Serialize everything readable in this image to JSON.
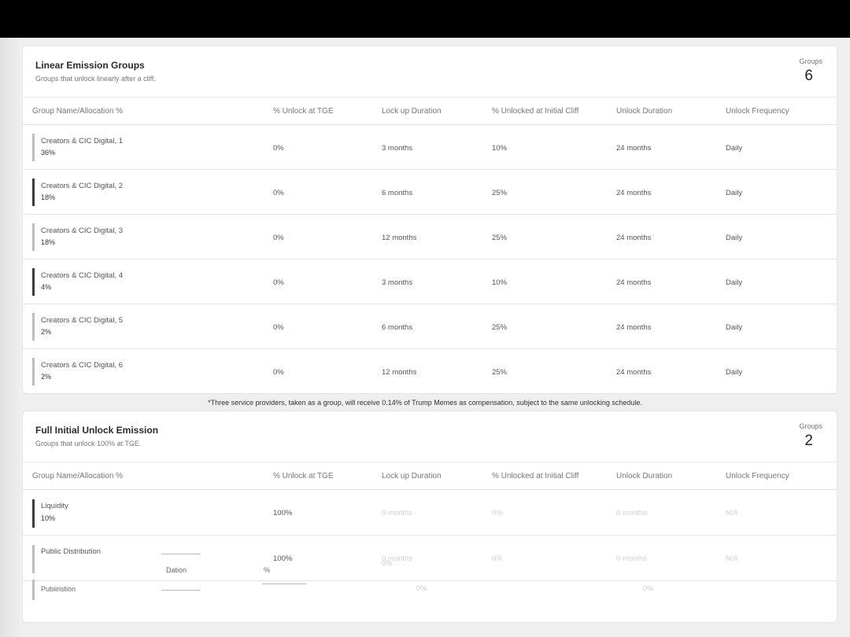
{
  "linear": {
    "title": "Linear Emission Groups",
    "subtitle": "Groups that unlock linearly after a cliff.",
    "count_label": "Groups",
    "count": "6",
    "columns": [
      "Group Name/Allocation %",
      "% Unlock at TGE",
      "Lock up Duration",
      "% Unlocked at Initial Cliff",
      "Unlock Duration",
      "Unlock Frequency"
    ],
    "rows": [
      {
        "name": "Creators & CIC Digital, 1",
        "pct": "36%",
        "tge": "0%",
        "lockup": "3 months",
        "cliff": "10%",
        "duration": "24 months",
        "freq": "Daily",
        "bar": "light"
      },
      {
        "name": "Creators & CIC Digital, 2",
        "pct": "18%",
        "tge": "0%",
        "lockup": "6 months",
        "cliff": "25%",
        "duration": "24 months",
        "freq": "Daily",
        "bar": "dark"
      },
      {
        "name": "Creators & CIC Digital, 3",
        "pct": "18%",
        "tge": "0%",
        "lockup": "12 months",
        "cliff": "25%",
        "duration": "24 months",
        "freq": "Daily",
        "bar": "light"
      },
      {
        "name": "Creators & CIC Digital, 4",
        "pct": "4%",
        "tge": "0%",
        "lockup": "3 months",
        "cliff": "10%",
        "duration": "24 months",
        "freq": "Daily",
        "bar": "dark"
      },
      {
        "name": "Creators & CIC Digital, 5",
        "pct": "2%",
        "tge": "0%",
        "lockup": "6 months",
        "cliff": "25%",
        "duration": "24 months",
        "freq": "Daily",
        "bar": "light"
      },
      {
        "name": "Creators & CIC Digital, 6",
        "pct": "2%",
        "tge": "0%",
        "lockup": "12 months",
        "cliff": "25%",
        "duration": "24 months",
        "freq": "Daily",
        "bar": "light"
      }
    ]
  },
  "footnote": "*Three service providers, taken as a group, will receive 0.14% of Trump Memes as compensation, subject to the same unlocking schedule.",
  "full": {
    "title": "Full Initial Unlock Emission",
    "subtitle": "Groups that unlock 100% at TGE.",
    "count_label": "Groups",
    "count": "2",
    "columns": [
      "Group Name/Allocation %",
      "% Unlock at TGE",
      "Lock up Duration",
      "% Unlocked at Initial Cliff",
      "Unlock Duration",
      "Unlock Frequency"
    ],
    "rows": [
      {
        "name": "Liquidity",
        "pct": "10%",
        "tge": "100%",
        "lockup": "0 months",
        "cliff": "0%",
        "duration": "0 months",
        "freq": "N/A",
        "bar": "dark"
      },
      {
        "name": "Public Distribution",
        "pct": "",
        "tge": "100%",
        "lockup": "0 months",
        "cliff": "0%",
        "duration": "0 months",
        "freq": "N/A",
        "bar": "light"
      }
    ],
    "artifacts": {
      "ghost_name": "Pubiiristion",
      "ghost_mid": "Dation",
      "ghost_pct": "%",
      "ghost_zero_a": "0%",
      "ghost_zero_b": "0%",
      "ghost_zero_c": "0%"
    }
  }
}
